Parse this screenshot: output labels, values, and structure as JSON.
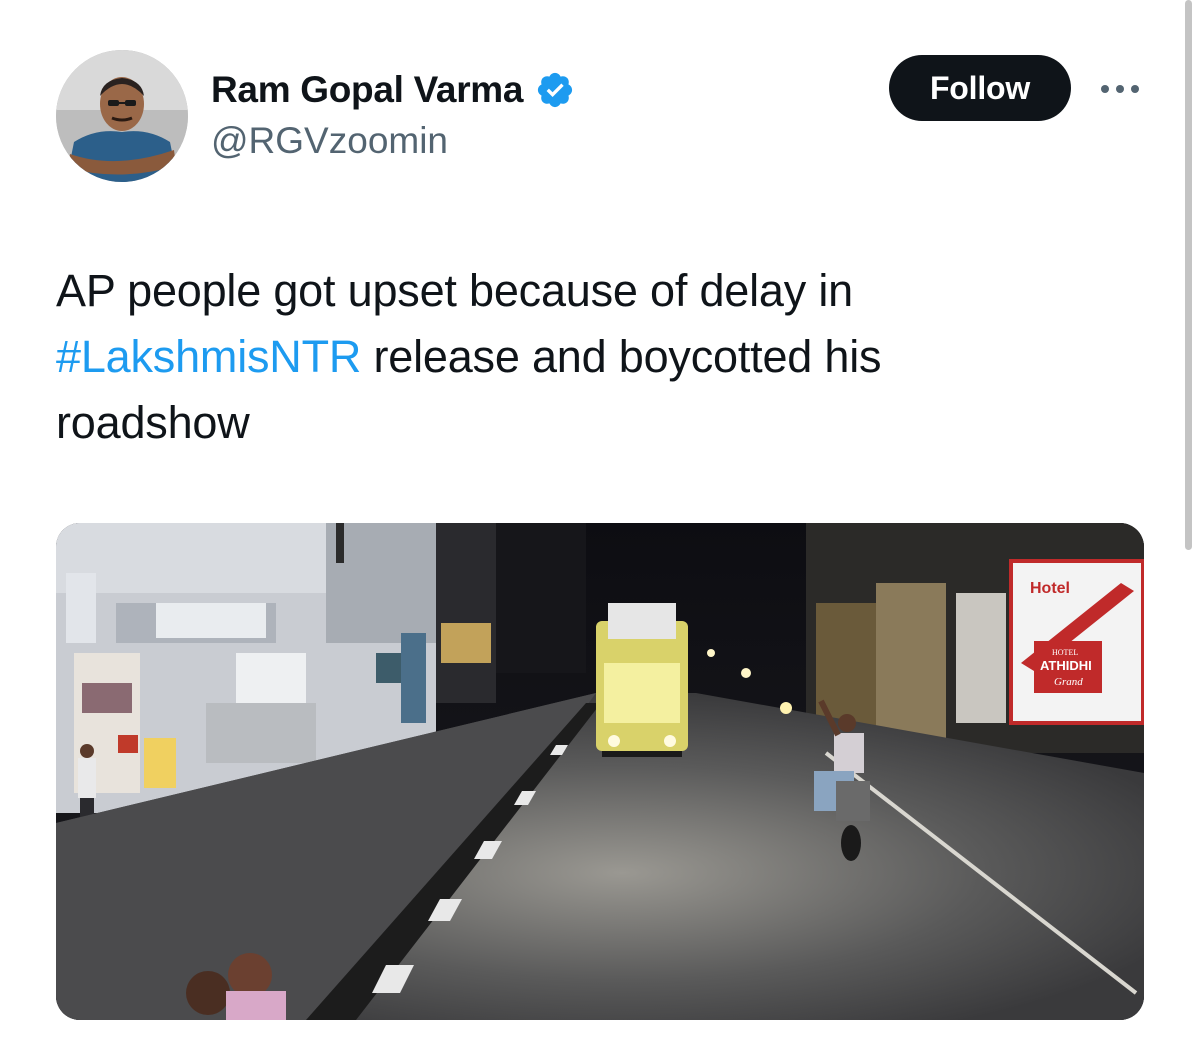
{
  "author": {
    "display_name": "Ram Gopal Varma",
    "handle": "@RGVzoomin",
    "verified": true,
    "avatar_icon": "profile-photo"
  },
  "actions": {
    "follow_label": "Follow",
    "more_icon": "more-horizontal-icon"
  },
  "tweet": {
    "text_before": "AP people got upset because of delay in ",
    "hashtag": "#LakshmisNTR",
    "text_after": " release and boycotted his roadshow"
  },
  "media": {
    "type": "photo",
    "signs": {
      "hotel_top": "Hotel",
      "hotel_small": "HOTEL",
      "hotel_name": "ATHIDHI",
      "hotel_script": "Grand"
    }
  },
  "colors": {
    "link": "#1d9bf0",
    "verified_badge": "#1d9bf0",
    "button_bg": "#0f1419",
    "secondary_text": "#536471"
  }
}
